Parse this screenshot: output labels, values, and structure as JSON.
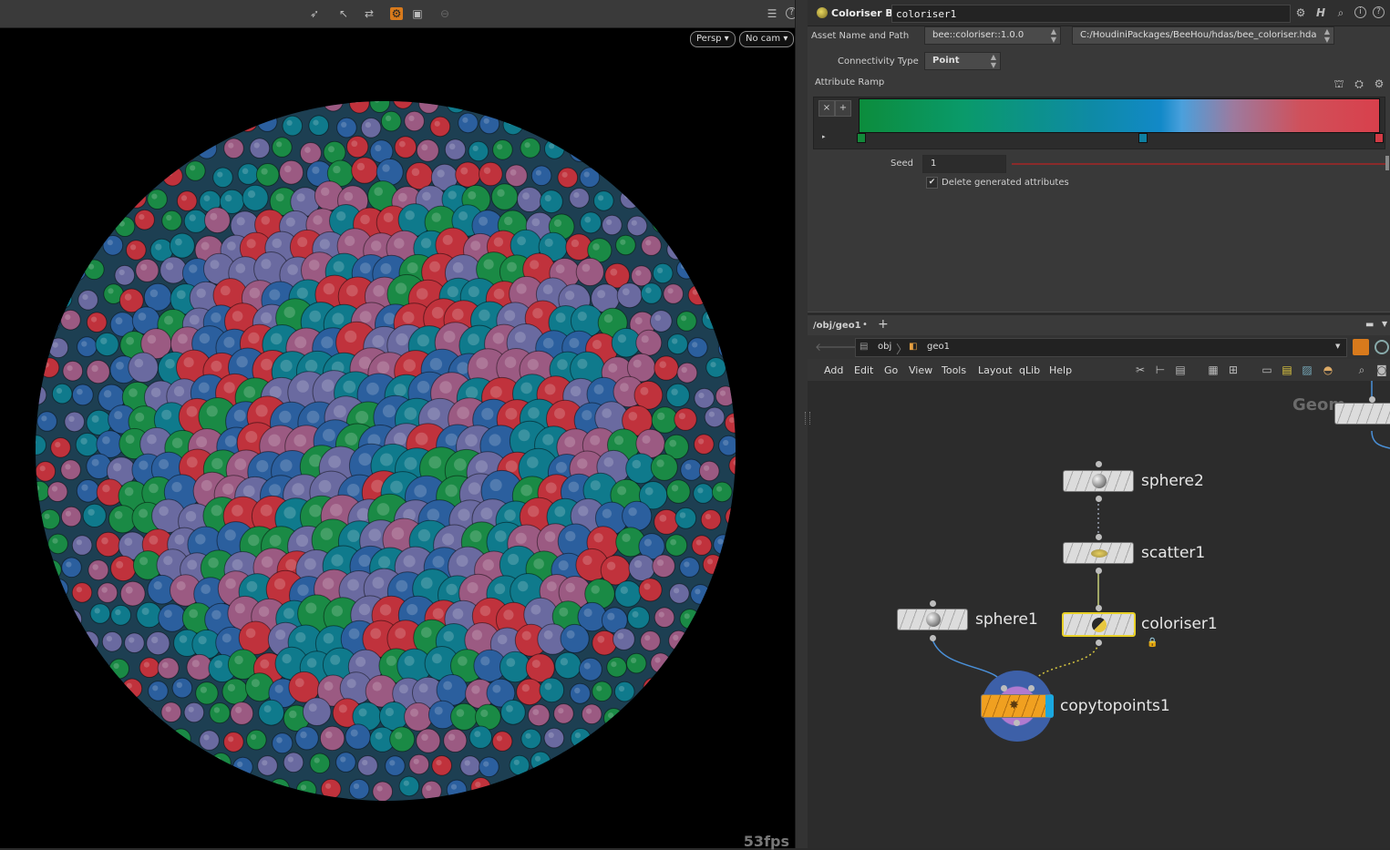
{
  "viewport": {
    "persp_label": "Persp",
    "cam_label": "No cam",
    "fps_text": "53fps",
    "sphere_colors": [
      "#0f7a8c",
      "#1a8a45",
      "#c0323c",
      "#9b5a82",
      "#6a6aa0",
      "#2b5f9e"
    ]
  },
  "params": {
    "node_type": "Coloriser Bee",
    "node_name": "coloriser1",
    "asset_label": "Asset Name and Path",
    "asset_name": "bee::coloriser::1.0.0",
    "asset_path": "C:/HoudiniPackages/BeeHou/hdas/bee_coloriser.hda",
    "connectivity_label": "Connectivity Type",
    "connectivity_value": "Point",
    "ramp_label": "Attribute Ramp",
    "ramp_key_colors": [
      "#138a3a",
      "#0f7fa0",
      "#d23b45"
    ],
    "seed_label": "Seed",
    "seed_value": "1",
    "delete_attr_label": "Delete generated attributes",
    "delete_attr_checked": true
  },
  "network": {
    "tab_label": "/obj/geo1",
    "path_obj": "obj",
    "path_geo": "geo1",
    "menu": [
      "Add",
      "Edit",
      "Go",
      "View",
      "Tools",
      "Layout",
      "qLib",
      "Help"
    ],
    "corner_label": "Geom",
    "nodes": {
      "sphere2": "sphere2",
      "scatter1": "scatter1",
      "sphere1": "sphere1",
      "coloriser1": "coloriser1",
      "copytopoints1": "copytopoints1"
    }
  }
}
